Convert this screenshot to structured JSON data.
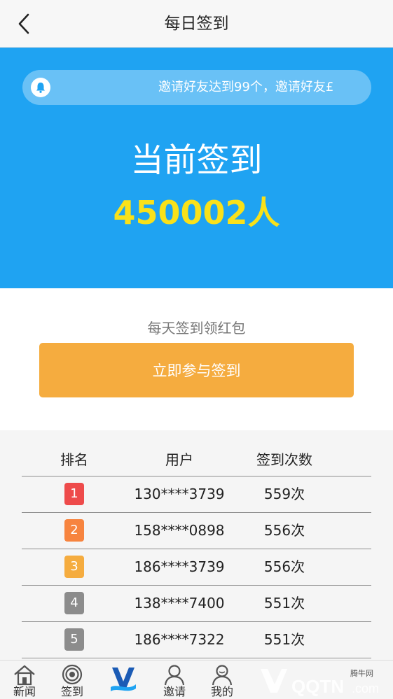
{
  "header": {
    "title": "每日签到",
    "back_icon": "chevron-left-icon"
  },
  "hero": {
    "notice_icon": "bell-icon",
    "notice_text": "邀请好友达到99个，邀请好友£",
    "label": "当前签到",
    "count": "450002人",
    "colors": {
      "background": "#1fa3f2",
      "count": "#f9e11a"
    }
  },
  "signin": {
    "subtitle": "每天签到领红包",
    "button_label": "立即参与签到",
    "button_color": "#f5ac3f"
  },
  "ranking": {
    "columns": [
      "排名",
      "用户",
      "签到次数"
    ],
    "rows": [
      {
        "rank": "1",
        "user": "130****3739",
        "times": "559次",
        "color": "#ee4b4b"
      },
      {
        "rank": "2",
        "user": "158****0898",
        "times": "556次",
        "color": "#f7843f"
      },
      {
        "rank": "3",
        "user": "186****3739",
        "times": "556次",
        "color": "#f5ac3f"
      },
      {
        "rank": "4",
        "user": "138****7400",
        "times": "551次",
        "color": "#8c8c8c"
      },
      {
        "rank": "5",
        "user": "186****7322",
        "times": "551次",
        "color": "#8c8c8c"
      }
    ]
  },
  "tabbar": {
    "tabs": [
      {
        "label": "新闻",
        "icon": "home-icon"
      },
      {
        "label": "签到",
        "icon": "target-icon"
      },
      {
        "label": "",
        "icon": "app-logo-icon"
      },
      {
        "label": "邀请",
        "icon": "user-icon"
      },
      {
        "label": "我的",
        "icon": "profile-icon"
      }
    ]
  },
  "watermark": {
    "site": "腾牛网",
    "brand": "QQTN",
    "suffix": ".com"
  }
}
